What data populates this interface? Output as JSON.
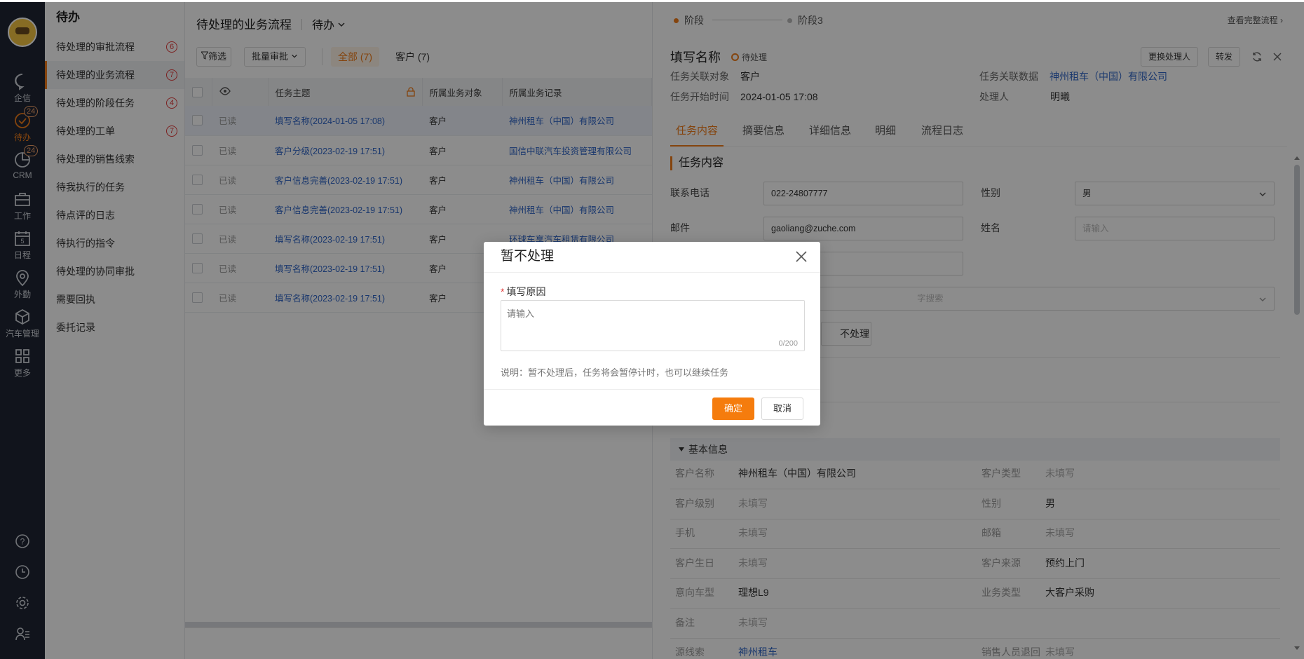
{
  "nav": {
    "items": [
      {
        "label": "企信",
        "icon": "chat-icon"
      },
      {
        "label": "待办",
        "icon": "check-circle-icon",
        "badge": "24"
      },
      {
        "label": "CRM",
        "icon": "pie-chart-icon",
        "badge": "24"
      },
      {
        "label": "工作",
        "icon": "briefcase-icon"
      },
      {
        "label": "日程",
        "icon": "calendar-icon",
        "calendar_day": "5"
      },
      {
        "label": "外勤",
        "icon": "location-pin-icon"
      },
      {
        "label": "汽车管理",
        "icon": "cube-icon"
      },
      {
        "label": "更多",
        "icon": "grid-icon"
      }
    ],
    "bottom_icons": [
      "help-icon",
      "clock-icon",
      "settings-icon",
      "user-list-icon"
    ]
  },
  "sidebar": {
    "title": "待办",
    "items": [
      {
        "label": "待处理的审批流程",
        "count": "6"
      },
      {
        "label": "待处理的业务流程",
        "count": "7"
      },
      {
        "label": "待处理的阶段任务",
        "count": "4"
      },
      {
        "label": "待处理的工单",
        "count": "7"
      },
      {
        "label": "待处理的销售线索"
      },
      {
        "label": "待我执行的任务"
      },
      {
        "label": "待点评的日志"
      },
      {
        "label": "待执行的指令"
      },
      {
        "label": "待处理的协同审批"
      },
      {
        "label": "需要回执"
      },
      {
        "label": "委托记录"
      }
    ]
  },
  "list": {
    "title": "待处理的业务流程",
    "mode": "待办",
    "filter_label": "筛选",
    "batch_label": "批量审批",
    "tabs": [
      "全部 (7)",
      "客户 (7)"
    ],
    "columns": [
      "任务主题",
      "所属业务对象",
      "所属业务记录"
    ],
    "rows": [
      {
        "status": "已读",
        "subject": "填写名称(2024-01-05 17:08)",
        "object": "客户",
        "record": "神州租车（中国）有限公司"
      },
      {
        "status": "已读",
        "subject": "客户分级(2023-02-19 17:51)",
        "object": "客户",
        "record": "国信中联汽车投资管理有限公司"
      },
      {
        "status": "已读",
        "subject": "客户信息完善(2023-02-19 17:51)",
        "object": "客户",
        "record": "神州租车（中国）有限公司"
      },
      {
        "status": "已读",
        "subject": "客户信息完善(2023-02-19 17:51)",
        "object": "客户",
        "record": "神州租车（中国）有限公司"
      },
      {
        "status": "已读",
        "subject": "填写名称(2023-02-19 17:51)",
        "object": "客户",
        "record": "环球车享汽车租赁有限公司"
      },
      {
        "status": "已读",
        "subject": "填写名称(2023-02-19 17:51)",
        "object": "客户",
        "record": ""
      },
      {
        "status": "已读",
        "subject": "填写名称(2023-02-19 17:51)",
        "object": "客户",
        "record": ""
      }
    ]
  },
  "detail": {
    "stage1": "阶段",
    "stage2": "阶段3",
    "full_flow_link": "查看完整流程 ›",
    "title": "填写名称",
    "status": "待处理",
    "change_handler": "更换处理人",
    "forward": "转发",
    "meta": {
      "obj_label": "任务关联对象",
      "obj_value": "客户",
      "data_label": "任务关联数据",
      "data_value": "神州租车（中国）有限公司",
      "start_label": "任务开始时间",
      "start_value": "2024-01-05 17:08",
      "handler_label": "处理人",
      "handler_value": "明曦"
    },
    "tabs": [
      "任务内容",
      "摘要信息",
      "详细信息",
      "明细",
      "流程日志"
    ],
    "section_title": "任务内容",
    "form": {
      "phone_label": "联系电话",
      "phone_value": "022-24807777",
      "gender_label": "性别",
      "gender_value": "男",
      "email_label": "邮件",
      "email_value": "gaoliang@zuche.com",
      "name_label": "姓名",
      "name_placeholder": "请输入",
      "search_placeholder": "字搜索",
      "pause_btn": "不处理"
    },
    "basic": {
      "title": "基本信息",
      "rows": [
        [
          {
            "k": "客户名称",
            "v": "神州租车（中国）有限公司"
          },
          {
            "k": "客户类型",
            "v": "未填写"
          }
        ],
        [
          {
            "k": "客户级别",
            "v": "未填写"
          },
          {
            "k": "性别",
            "v": "男"
          }
        ],
        [
          {
            "k": "手机",
            "v": "未填写"
          },
          {
            "k": "邮箱",
            "v": "未填写"
          }
        ],
        [
          {
            "k": "客户生日",
            "v": "未填写"
          },
          {
            "k": "客户来源",
            "v": "预约上门"
          }
        ],
        [
          {
            "k": "意向车型",
            "v": "理想L9"
          },
          {
            "k": "业务类型",
            "v": "大客户采购"
          }
        ],
        [
          {
            "k": "备注",
            "v": "未填写"
          },
          {
            "k": "",
            "v": ""
          }
        ],
        [
          {
            "k": "源线索",
            "v": "神州租车"
          },
          {
            "k": "销售人员退回",
            "v": "未填写"
          }
        ]
      ]
    }
  },
  "dialog": {
    "title": "暂不处理",
    "field_label": "填写原因",
    "placeholder": "请输入",
    "counter": "0/200",
    "note": "说明：暂不处理后，任务将会暂停计时，也可以继续任务",
    "confirm": "确定",
    "cancel": "取消"
  },
  "colors": {
    "accent": "#f07d1a",
    "link": "#2e64c7",
    "nav_bg": "#1f2633",
    "badge_red": "#e23b3b"
  }
}
